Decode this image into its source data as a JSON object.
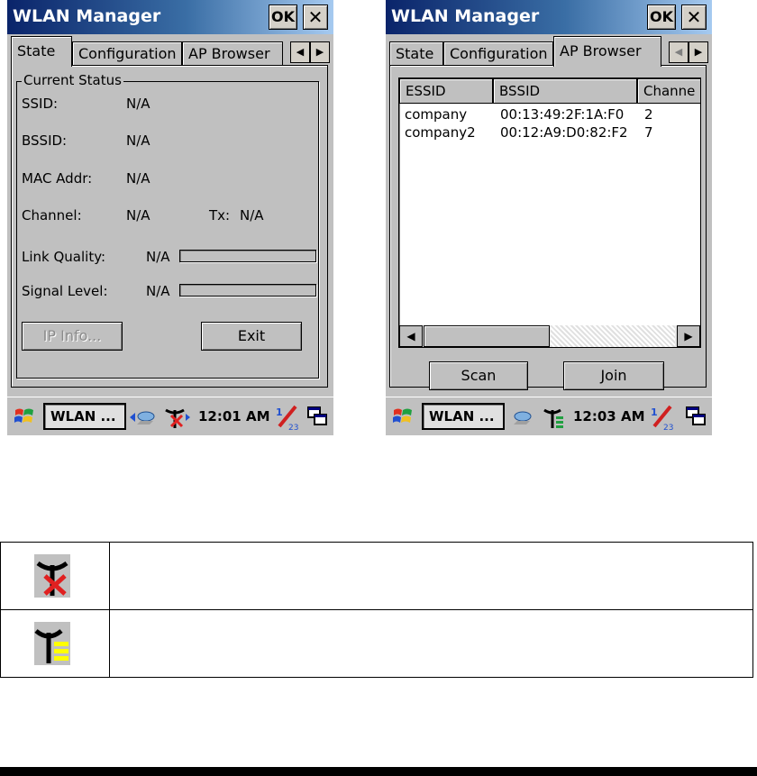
{
  "left_screen": {
    "title": "WLAN Manager",
    "ok_label": "OK",
    "close_label": "✕",
    "tabs": [
      {
        "label": "State"
      },
      {
        "label": "Configuration"
      },
      {
        "label": "AP Browser"
      }
    ],
    "active_tab": "State",
    "group_label": "Current Status",
    "fields": {
      "ssid_label": "SSID:",
      "ssid_value": "N/A",
      "bssid_label": "BSSID:",
      "bssid_value": "N/A",
      "mac_label": "MAC Addr:",
      "mac_value": "N/A",
      "channel_label": "Channel:",
      "channel_value": "N/A",
      "tx_label": "Tx:",
      "tx_value": "N/A",
      "link_label": "Link Quality:",
      "link_value": "N/A",
      "signal_label": "Signal Level:",
      "signal_value": "N/A"
    },
    "link_quality_level": 0,
    "signal_level": 0,
    "ip_info_button": "IP Info...",
    "exit_button": "Exit",
    "taskbar": {
      "task_label": "WLAN ...",
      "clock": "12:01 AM"
    }
  },
  "right_screen": {
    "title": "WLAN Manager",
    "ok_label": "OK",
    "close_label": "✕",
    "tabs": [
      {
        "label": "State"
      },
      {
        "label": "Configuration"
      },
      {
        "label": "AP Browser"
      }
    ],
    "active_tab": "AP Browser",
    "columns": [
      "ESSID",
      "BSSID",
      "Channe"
    ],
    "rows": [
      {
        "essid": "company",
        "bssid": "00:13:49:2F:1A:F0",
        "channel": "2"
      },
      {
        "essid": "company2",
        "bssid": "00:12:A9:D0:82:F2",
        "channel": "7"
      }
    ],
    "scan_button": "Scan",
    "join_button": "Join",
    "taskbar": {
      "task_label": "WLAN ...",
      "clock": "12:03 AM"
    }
  },
  "legend": [
    {
      "icon": "wlan-disconnected-icon",
      "description": ""
    },
    {
      "icon": "wlan-connected-icon",
      "description": ""
    }
  ],
  "colors": {
    "titlebar_start": "#0a246a",
    "titlebar_end": "#a6caf0",
    "window_bg": "#c0c0c0",
    "disconnected_x": "#e02020",
    "signal_bars": "#ffff00"
  }
}
